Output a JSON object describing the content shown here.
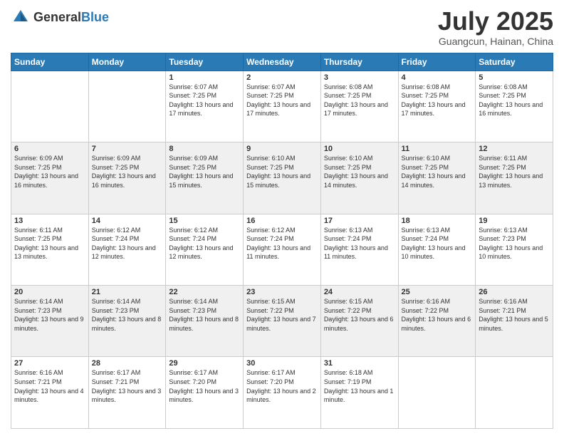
{
  "logo": {
    "general": "General",
    "blue": "Blue"
  },
  "header": {
    "month": "July 2025",
    "location": "Guangcun, Hainan, China"
  },
  "weekdays": [
    "Sunday",
    "Monday",
    "Tuesday",
    "Wednesday",
    "Thursday",
    "Friday",
    "Saturday"
  ],
  "rows": [
    [
      {
        "day": "",
        "sunrise": "",
        "sunset": "",
        "daylight": ""
      },
      {
        "day": "",
        "sunrise": "",
        "sunset": "",
        "daylight": ""
      },
      {
        "day": "1",
        "sunrise": "Sunrise: 6:07 AM",
        "sunset": "Sunset: 7:25 PM",
        "daylight": "Daylight: 13 hours and 17 minutes."
      },
      {
        "day": "2",
        "sunrise": "Sunrise: 6:07 AM",
        "sunset": "Sunset: 7:25 PM",
        "daylight": "Daylight: 13 hours and 17 minutes."
      },
      {
        "day": "3",
        "sunrise": "Sunrise: 6:08 AM",
        "sunset": "Sunset: 7:25 PM",
        "daylight": "Daylight: 13 hours and 17 minutes."
      },
      {
        "day": "4",
        "sunrise": "Sunrise: 6:08 AM",
        "sunset": "Sunset: 7:25 PM",
        "daylight": "Daylight: 13 hours and 17 minutes."
      },
      {
        "day": "5",
        "sunrise": "Sunrise: 6:08 AM",
        "sunset": "Sunset: 7:25 PM",
        "daylight": "Daylight: 13 hours and 16 minutes."
      }
    ],
    [
      {
        "day": "6",
        "sunrise": "Sunrise: 6:09 AM",
        "sunset": "Sunset: 7:25 PM",
        "daylight": "Daylight: 13 hours and 16 minutes."
      },
      {
        "day": "7",
        "sunrise": "Sunrise: 6:09 AM",
        "sunset": "Sunset: 7:25 PM",
        "daylight": "Daylight: 13 hours and 16 minutes."
      },
      {
        "day": "8",
        "sunrise": "Sunrise: 6:09 AM",
        "sunset": "Sunset: 7:25 PM",
        "daylight": "Daylight: 13 hours and 15 minutes."
      },
      {
        "day": "9",
        "sunrise": "Sunrise: 6:10 AM",
        "sunset": "Sunset: 7:25 PM",
        "daylight": "Daylight: 13 hours and 15 minutes."
      },
      {
        "day": "10",
        "sunrise": "Sunrise: 6:10 AM",
        "sunset": "Sunset: 7:25 PM",
        "daylight": "Daylight: 13 hours and 14 minutes."
      },
      {
        "day": "11",
        "sunrise": "Sunrise: 6:10 AM",
        "sunset": "Sunset: 7:25 PM",
        "daylight": "Daylight: 13 hours and 14 minutes."
      },
      {
        "day": "12",
        "sunrise": "Sunrise: 6:11 AM",
        "sunset": "Sunset: 7:25 PM",
        "daylight": "Daylight: 13 hours and 13 minutes."
      }
    ],
    [
      {
        "day": "13",
        "sunrise": "Sunrise: 6:11 AM",
        "sunset": "Sunset: 7:25 PM",
        "daylight": "Daylight: 13 hours and 13 minutes."
      },
      {
        "day": "14",
        "sunrise": "Sunrise: 6:12 AM",
        "sunset": "Sunset: 7:24 PM",
        "daylight": "Daylight: 13 hours and 12 minutes."
      },
      {
        "day": "15",
        "sunrise": "Sunrise: 6:12 AM",
        "sunset": "Sunset: 7:24 PM",
        "daylight": "Daylight: 13 hours and 12 minutes."
      },
      {
        "day": "16",
        "sunrise": "Sunrise: 6:12 AM",
        "sunset": "Sunset: 7:24 PM",
        "daylight": "Daylight: 13 hours and 11 minutes."
      },
      {
        "day": "17",
        "sunrise": "Sunrise: 6:13 AM",
        "sunset": "Sunset: 7:24 PM",
        "daylight": "Daylight: 13 hours and 11 minutes."
      },
      {
        "day": "18",
        "sunrise": "Sunrise: 6:13 AM",
        "sunset": "Sunset: 7:24 PM",
        "daylight": "Daylight: 13 hours and 10 minutes."
      },
      {
        "day": "19",
        "sunrise": "Sunrise: 6:13 AM",
        "sunset": "Sunset: 7:23 PM",
        "daylight": "Daylight: 13 hours and 10 minutes."
      }
    ],
    [
      {
        "day": "20",
        "sunrise": "Sunrise: 6:14 AM",
        "sunset": "Sunset: 7:23 PM",
        "daylight": "Daylight: 13 hours and 9 minutes."
      },
      {
        "day": "21",
        "sunrise": "Sunrise: 6:14 AM",
        "sunset": "Sunset: 7:23 PM",
        "daylight": "Daylight: 13 hours and 8 minutes."
      },
      {
        "day": "22",
        "sunrise": "Sunrise: 6:14 AM",
        "sunset": "Sunset: 7:23 PM",
        "daylight": "Daylight: 13 hours and 8 minutes."
      },
      {
        "day": "23",
        "sunrise": "Sunrise: 6:15 AM",
        "sunset": "Sunset: 7:22 PM",
        "daylight": "Daylight: 13 hours and 7 minutes."
      },
      {
        "day": "24",
        "sunrise": "Sunrise: 6:15 AM",
        "sunset": "Sunset: 7:22 PM",
        "daylight": "Daylight: 13 hours and 6 minutes."
      },
      {
        "day": "25",
        "sunrise": "Sunrise: 6:16 AM",
        "sunset": "Sunset: 7:22 PM",
        "daylight": "Daylight: 13 hours and 6 minutes."
      },
      {
        "day": "26",
        "sunrise": "Sunrise: 6:16 AM",
        "sunset": "Sunset: 7:21 PM",
        "daylight": "Daylight: 13 hours and 5 minutes."
      }
    ],
    [
      {
        "day": "27",
        "sunrise": "Sunrise: 6:16 AM",
        "sunset": "Sunset: 7:21 PM",
        "daylight": "Daylight: 13 hours and 4 minutes."
      },
      {
        "day": "28",
        "sunrise": "Sunrise: 6:17 AM",
        "sunset": "Sunset: 7:21 PM",
        "daylight": "Daylight: 13 hours and 3 minutes."
      },
      {
        "day": "29",
        "sunrise": "Sunrise: 6:17 AM",
        "sunset": "Sunset: 7:20 PM",
        "daylight": "Daylight: 13 hours and 3 minutes."
      },
      {
        "day": "30",
        "sunrise": "Sunrise: 6:17 AM",
        "sunset": "Sunset: 7:20 PM",
        "daylight": "Daylight: 13 hours and 2 minutes."
      },
      {
        "day": "31",
        "sunrise": "Sunrise: 6:18 AM",
        "sunset": "Sunset: 7:19 PM",
        "daylight": "Daylight: 13 hours and 1 minute."
      },
      {
        "day": "",
        "sunrise": "",
        "sunset": "",
        "daylight": ""
      },
      {
        "day": "",
        "sunrise": "",
        "sunset": "",
        "daylight": ""
      }
    ]
  ]
}
